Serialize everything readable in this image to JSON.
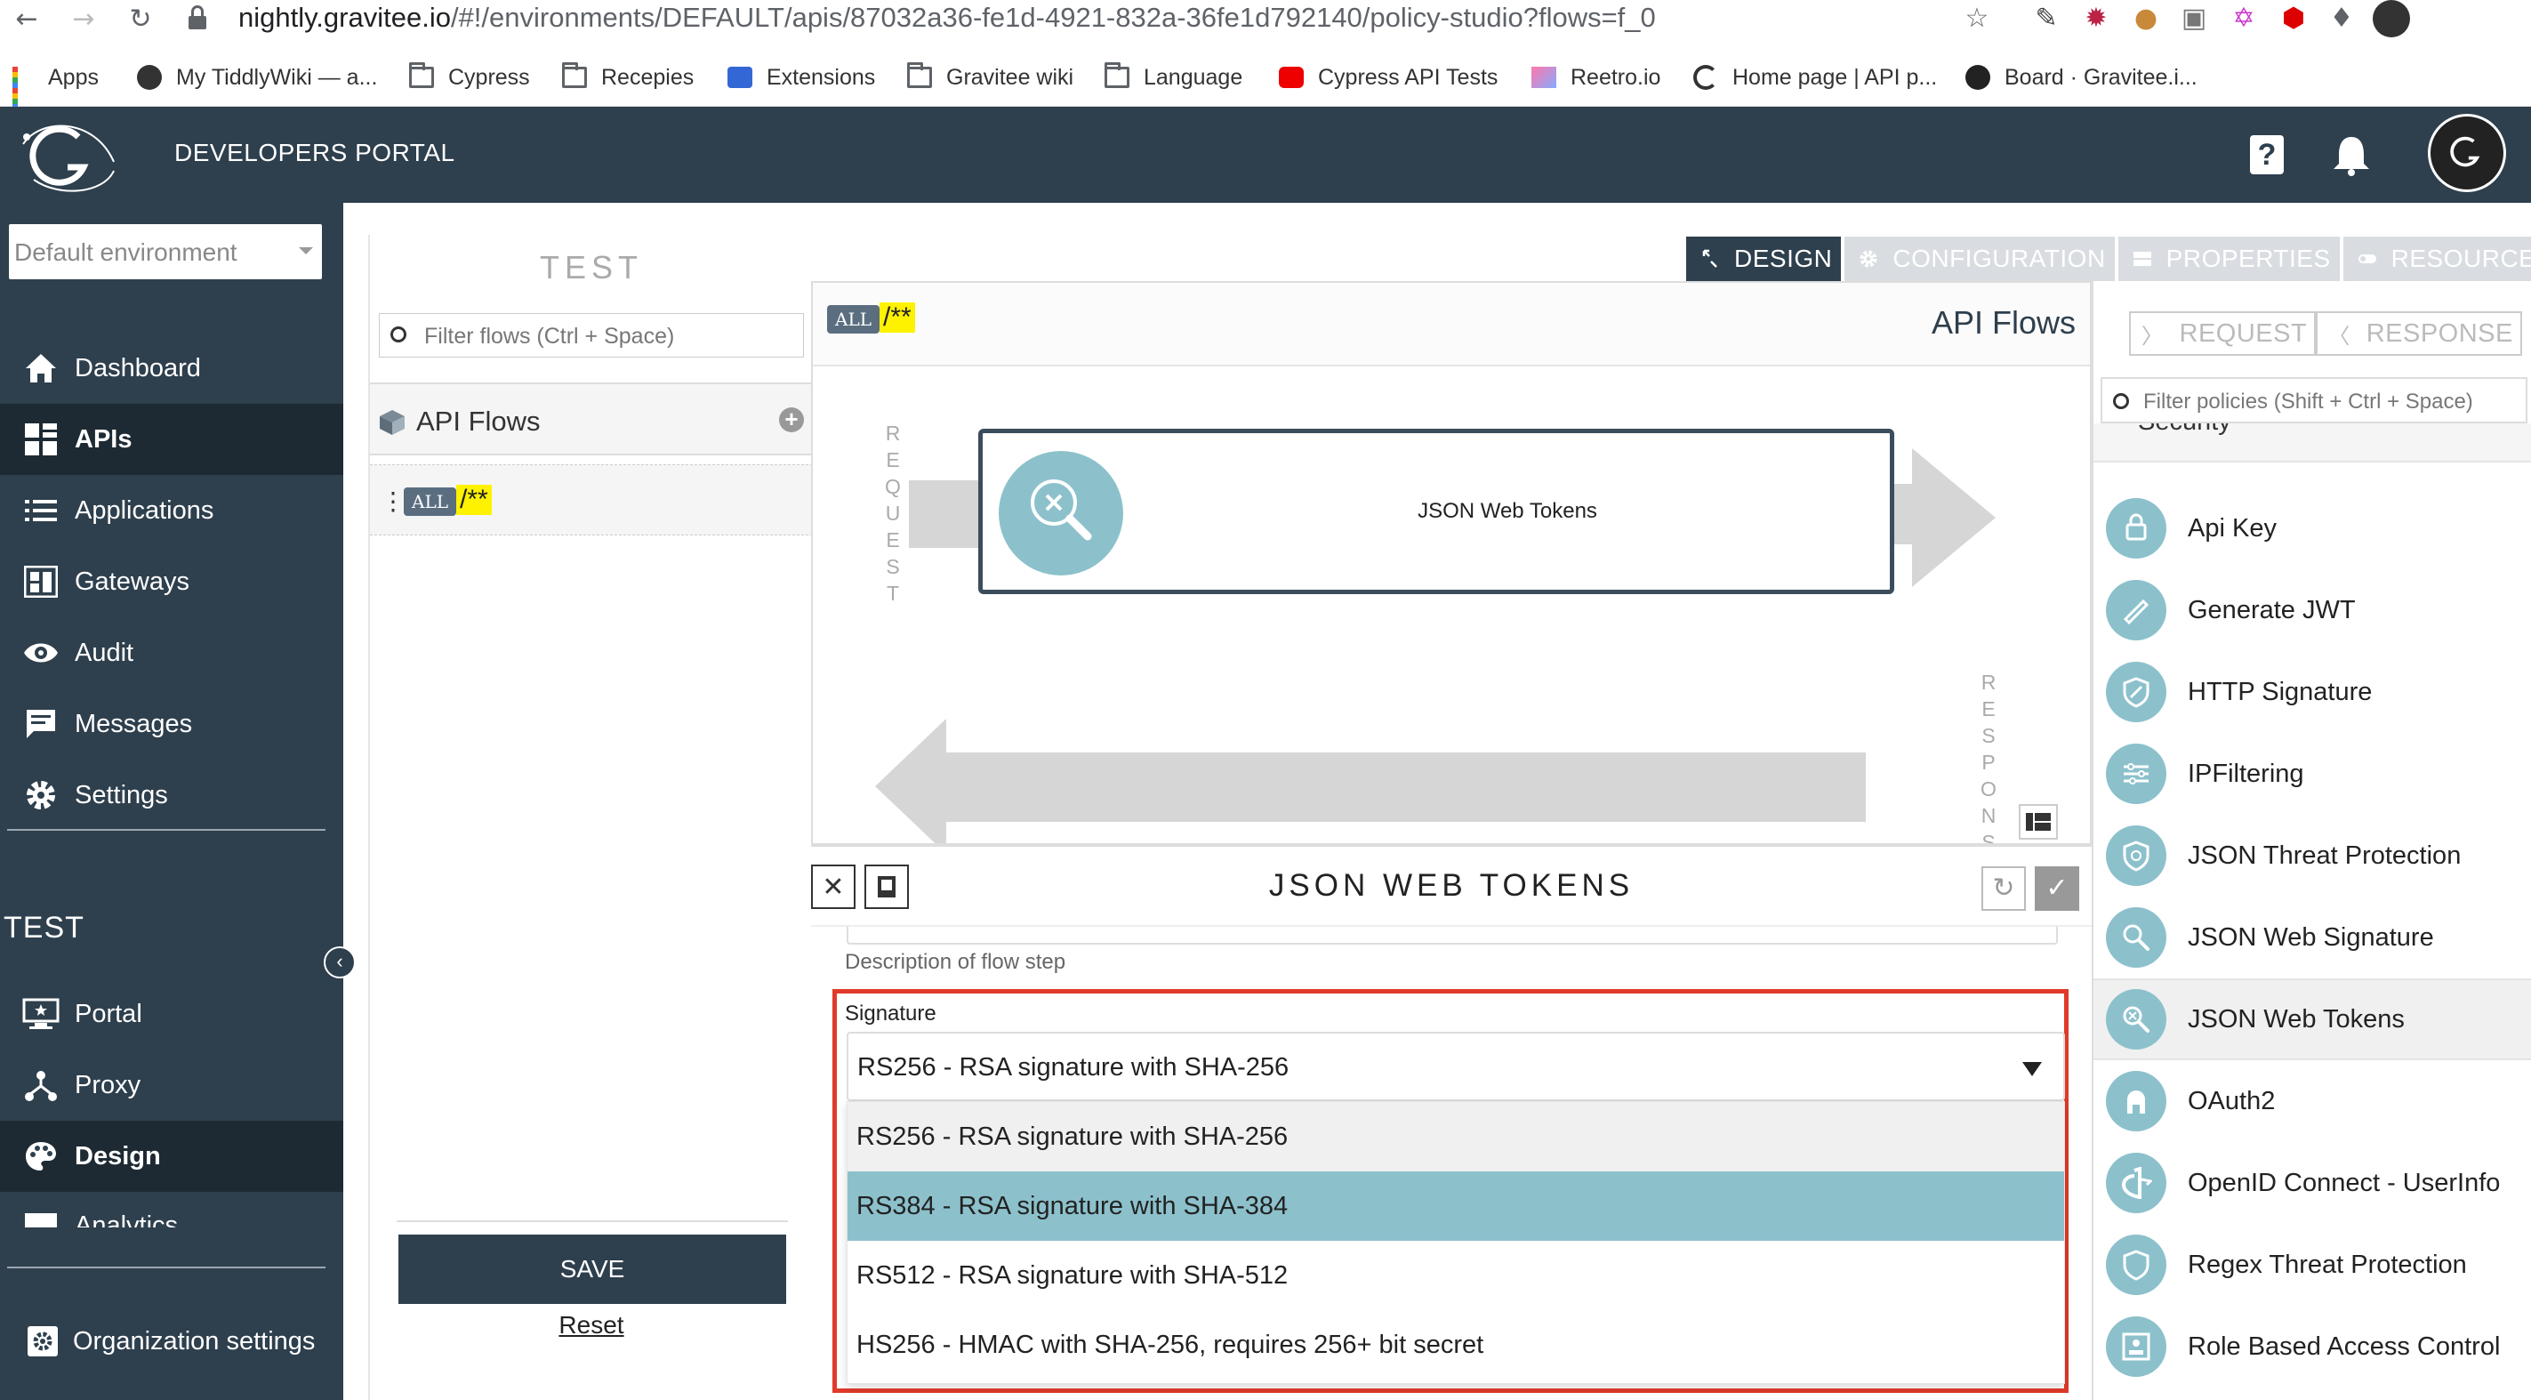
{
  "browser": {
    "url_host": "nightly.gravitee.io",
    "url_path": "/#!/environments/DEFAULT/apis/87032a36-fe1d-4921-832a-36fe1d792140/policy-studio?flows=f_0",
    "bookmarks": [
      {
        "label": "Apps",
        "icon": "apps-grid-icon"
      },
      {
        "label": "My TiddlyWiki — a...",
        "icon": "globe-icon"
      },
      {
        "label": "Cypress",
        "icon": "folder-icon"
      },
      {
        "label": "Recepies",
        "icon": "folder-icon"
      },
      {
        "label": "Extensions",
        "icon": "puzzle-icon"
      },
      {
        "label": "Gravitee wiki",
        "icon": "folder-icon"
      },
      {
        "label": "Language",
        "icon": "folder-icon"
      },
      {
        "label": "Cypress API Tests",
        "icon": "youtube-icon"
      },
      {
        "label": "Reetro.io",
        "icon": "reetro-icon"
      },
      {
        "label": "Home page | API p...",
        "icon": "gravitee-icon"
      },
      {
        "label": "Board · Gravitee.i...",
        "icon": "github-icon"
      }
    ]
  },
  "header": {
    "title": "DEVELOPERS PORTAL"
  },
  "sidebar": {
    "environment": "Default environment",
    "items": [
      {
        "label": "Dashboard",
        "icon": "home-icon"
      },
      {
        "label": "APIs",
        "icon": "apis-grid-icon"
      },
      {
        "label": "Applications",
        "icon": "list-icon"
      },
      {
        "label": "Gateways",
        "icon": "gateway-icon"
      },
      {
        "label": "Audit",
        "icon": "eye-icon"
      },
      {
        "label": "Messages",
        "icon": "message-icon"
      },
      {
        "label": "Settings",
        "icon": "gear-icon"
      }
    ],
    "section": "TEST",
    "sub_items": [
      {
        "label": "Portal",
        "icon": "portal-icon"
      },
      {
        "label": "Proxy",
        "icon": "proxy-icon"
      },
      {
        "label": "Design",
        "icon": "palette-icon"
      },
      {
        "label": "Analytics",
        "icon": "analytics-icon"
      }
    ],
    "org_settings": "Organization settings"
  },
  "flows": {
    "title": "TEST",
    "filter_placeholder": "Filter flows (Ctrl + Space)",
    "group_label": "API Flows",
    "flow_method": "ALL",
    "flow_path": "/**",
    "save": "SAVE",
    "reset": "Reset"
  },
  "tabs": [
    {
      "label": "DESIGN",
      "active": true
    },
    {
      "label": "CONFIGURATION",
      "active": false
    },
    {
      "label": "PROPERTIES",
      "active": false
    },
    {
      "label": "RESOURCES",
      "active": false
    }
  ],
  "canvas": {
    "method": "ALL",
    "path": "/**",
    "title": "API Flows",
    "request_label": "REQUEST",
    "response_label": "RESPONSE",
    "policy_name": "JSON Web Tokens"
  },
  "form": {
    "title": "JSON WEB TOKENS",
    "desc_label": "Description of flow step",
    "signature_label": "Signature",
    "signature_value": "RS256 - RSA signature with SHA-256",
    "options": [
      "RS256 - RSA signature with SHA-256",
      "RS384 - RSA signature with SHA-384",
      "RS512 - RSA signature with SHA-512",
      "HS256 - HMAC with SHA-256, requires 256+ bit secret"
    ]
  },
  "policies": {
    "request_label": "REQUEST",
    "response_label": "RESPONSE",
    "filter_placeholder": "Filter policies (Shift + Ctrl + Space)",
    "cut_label": "Security",
    "items": [
      "Api Key",
      "Generate JWT",
      "HTTP Signature",
      "IPFiltering",
      "JSON Threat Protection",
      "JSON Web Signature",
      "JSON Web Tokens",
      "OAuth2",
      "OpenID Connect - UserInfo",
      "Regex Threat Protection",
      "Role Based Access Control"
    ]
  },
  "colors": {
    "header_bg": "#2e3f4d",
    "policy_teal": "#8cc1cc",
    "highlight": "#e03a2a",
    "path_chip": "#fff200"
  }
}
